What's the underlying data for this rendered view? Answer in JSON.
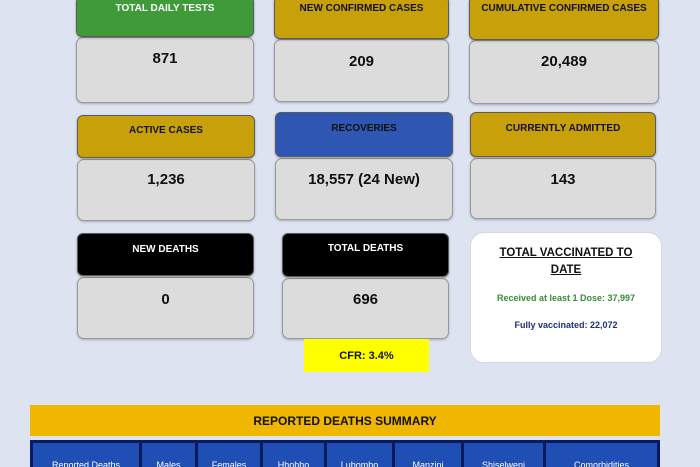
{
  "cards": {
    "total_daily_tests": {
      "label": "TOTAL DAILY TESTS",
      "value": "871"
    },
    "new_confirmed_cases": {
      "label": "NEW CONFIRMED CASES",
      "value": "209"
    },
    "cumulative_confirmed_cases": {
      "label": "CUMULATIVE CONFIRMED CASES",
      "value": "20,489"
    },
    "active_cases": {
      "label": "ACTIVE CASES",
      "value": "1,236"
    },
    "recoveries": {
      "label": "RECOVERIES",
      "value": "18,557 (24 New)"
    },
    "currently_admitted": {
      "label": "CURRENTLY ADMITTED",
      "value": "143"
    },
    "new_deaths": {
      "label": "NEW DEATHS",
      "value": "0"
    },
    "total_deaths": {
      "label": "TOTAL DEATHS",
      "value": "696"
    }
  },
  "vaccination": {
    "title": "TOTAL VACCINATED TO DATE",
    "dose1": "Received at least 1 Dose: 37,997",
    "full": "Fully vaccinated: 22,072"
  },
  "cfr": "CFR: 3.4%",
  "deaths_summary": {
    "title": "REPORTED DEATHS SUMMARY",
    "columns": [
      "Reported Deaths",
      "Males",
      "Females",
      "Hhohho",
      "Lubombo",
      "Manzini",
      "Shiselweni",
      "Comorbidities"
    ]
  },
  "colors": {
    "background": "#dde3f1",
    "green": "#3f9a3a",
    "gold": "#c8a10a",
    "blue": "#2f56b2",
    "black": "#000000",
    "cfr_yellow": "#ffff00",
    "banner": "#f0b700"
  }
}
